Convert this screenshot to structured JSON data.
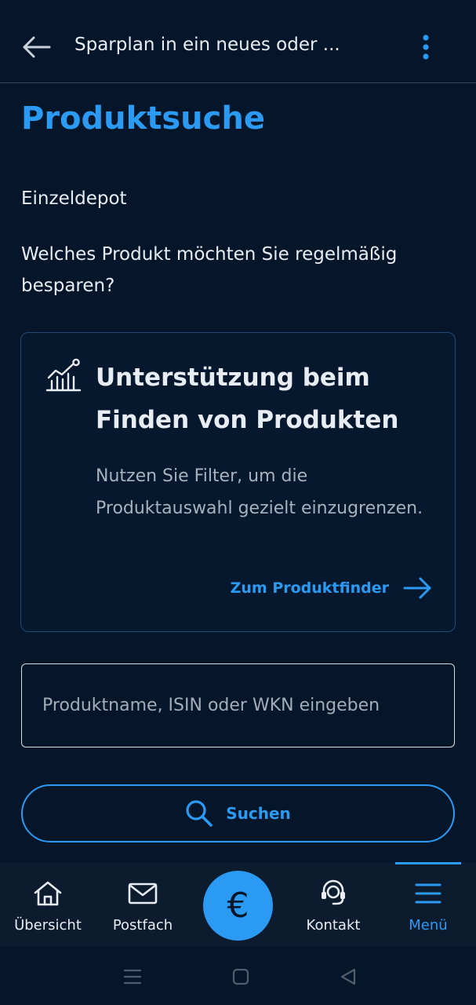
{
  "appbar": {
    "title": "Sparplan in ein neues oder ...",
    "back_icon": "arrow-left-icon",
    "more_icon": "more-vertical-icon"
  },
  "main": {
    "title": "Produktsuche",
    "depot": "Einzeldepot",
    "question": "Welches Produkt möchten Sie regelmäßig besparen?"
  },
  "card": {
    "icon": "chart-growth-icon",
    "title": "Unterstützung beim Finden von Produkten",
    "text": "Nutzen Sie Filter, um die Produktauswahl gezielt einzugrenzen.",
    "link_label": "Zum Produktfinder",
    "link_icon": "arrow-right-icon"
  },
  "search": {
    "placeholder": "Produktname, ISIN oder WKN eingeben",
    "value": "",
    "button_label": "Suchen",
    "button_icon": "search-icon"
  },
  "bottom_nav": {
    "items": [
      {
        "label": "Übersicht",
        "icon": "home-icon",
        "active": false
      },
      {
        "label": "Postfach",
        "icon": "mail-icon",
        "active": false
      },
      {
        "label": "€",
        "icon": "euro-icon",
        "active": false
      },
      {
        "label": "Kontakt",
        "icon": "headset-icon",
        "active": false
      },
      {
        "label": "Menü",
        "icon": "menu-icon",
        "active": true
      }
    ]
  },
  "colors": {
    "background": "#06162a",
    "accent": "#2b9af3",
    "nav_background": "#0c1b2e",
    "muted_text": "#a7b2bf"
  }
}
